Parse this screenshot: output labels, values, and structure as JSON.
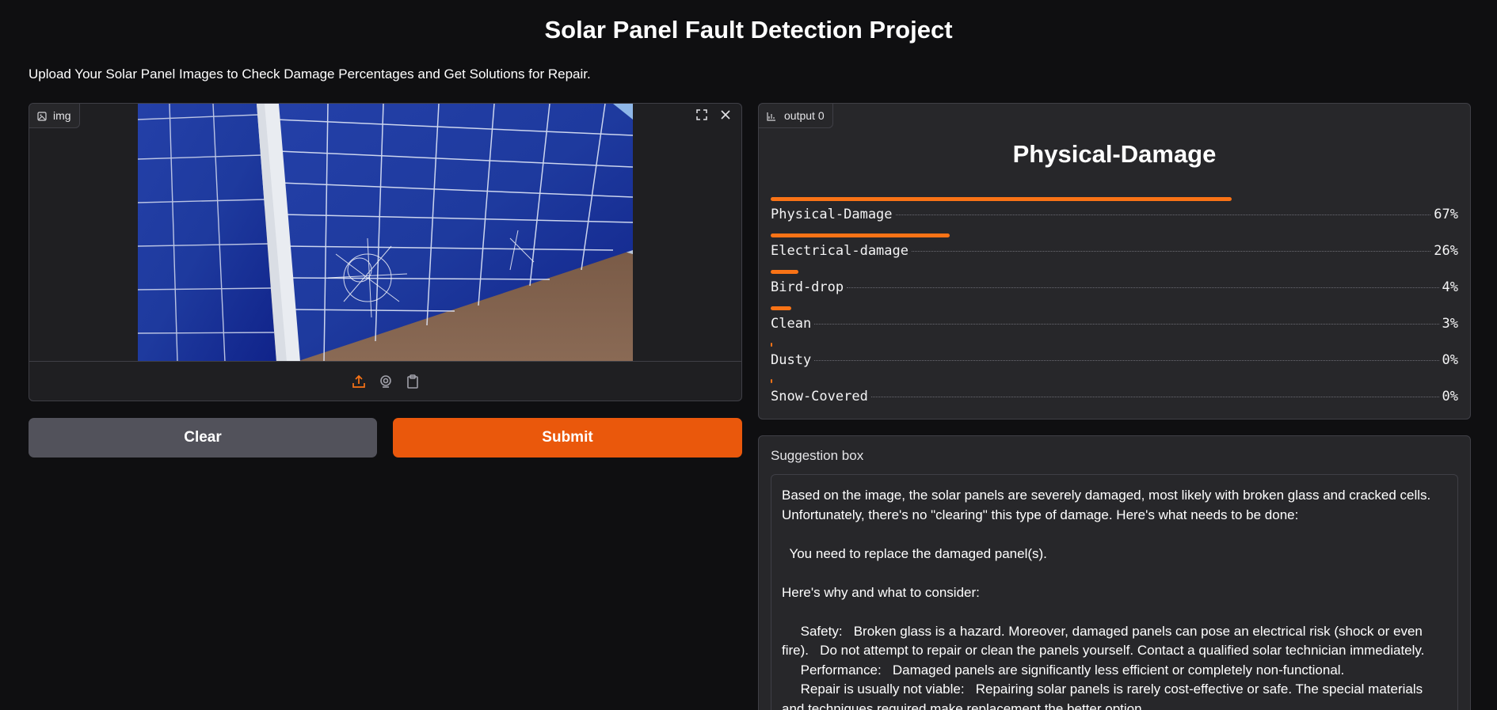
{
  "page": {
    "title": "Solar Panel Fault Detection Project",
    "description": "Upload Your Solar Panel Images to Check Damage Percentages and Get Solutions for Repair."
  },
  "input": {
    "label": "img",
    "image_content": "Close-up of a blue photovoltaic solar panel with shattered glass and cracked cells"
  },
  "buttons": {
    "clear": "Clear",
    "submit": "Submit"
  },
  "output": {
    "label": "output 0",
    "top_class": "Physical-Damage",
    "confidences": [
      {
        "label": "Physical-Damage",
        "value": 0.67,
        "display": "67%"
      },
      {
        "label": "Electrical-damage",
        "value": 0.26,
        "display": "26%"
      },
      {
        "label": "Bird-drop",
        "value": 0.04,
        "display": "4%"
      },
      {
        "label": "Clean",
        "value": 0.03,
        "display": "3%"
      },
      {
        "label": "Dusty",
        "value": 0.0,
        "display": "0%"
      },
      {
        "label": "Snow-Covered",
        "value": 0.0,
        "display": "0%"
      }
    ]
  },
  "suggestion": {
    "label": "Suggestion box",
    "paragraphs": [
      "Based on the image, the solar panels are severely damaged, most likely with broken glass and cracked cells. Unfortunately, there's no \"clearing\" this type of damage. Here's what needs to be done:",
      "",
      "  You need to replace the damaged panel(s).",
      "",
      "Here's why and what to consider:",
      "",
      "     Safety:   Broken glass is a hazard. Moreover, damaged panels can pose an electrical risk (shock or even fire).   Do not attempt to repair or clean the panels yourself. Contact a qualified solar technician immediately.",
      "     Performance:   Damaged panels are significantly less efficient or completely non-functional.",
      "     Repair is usually not viable:   Repairing solar panels is rarely cost-effective or safe. The special materials and techniques required make replacement the better option."
    ]
  },
  "colors": {
    "background": "#0f0f11",
    "panel": "#27272a",
    "accent": "#ea580c",
    "bar": "#f97316",
    "secondary_button": "#52525b"
  },
  "icons": {
    "input_tag": "image-icon",
    "output_tag": "bar-chart-icon",
    "fullscreen": "fullscreen-icon",
    "close": "close-icon",
    "upload": "upload-icon",
    "webcam": "webcam-icon",
    "clipboard": "clipboard-icon"
  }
}
